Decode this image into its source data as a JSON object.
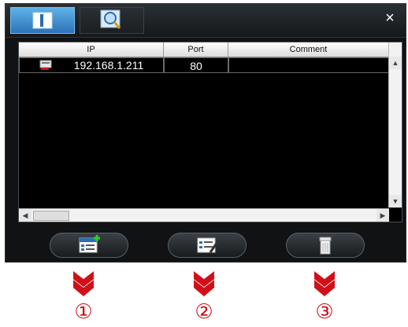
{
  "window": {
    "tabs": [
      {
        "name": "info",
        "icon": "info-icon",
        "active": true
      },
      {
        "name": "search",
        "icon": "search-icon",
        "active": false
      }
    ],
    "close_label": "×"
  },
  "table": {
    "columns": [
      "IP",
      "Port",
      "Comment"
    ],
    "rows": [
      {
        "ip": "192.168.1.211",
        "port": "80",
        "comment": ""
      }
    ]
  },
  "buttons": [
    {
      "name": "add-device-button",
      "icon": "add-list-icon"
    },
    {
      "name": "edit-device-button",
      "icon": "edit-list-icon"
    },
    {
      "name": "delete-device-button",
      "icon": "trash-icon"
    }
  ],
  "annotations": {
    "markers": [
      "①",
      "②",
      "③"
    ],
    "arrow_color": "#c8101a"
  },
  "colors": {
    "accent": "#3a8fd6",
    "window_bg": "#101214"
  }
}
